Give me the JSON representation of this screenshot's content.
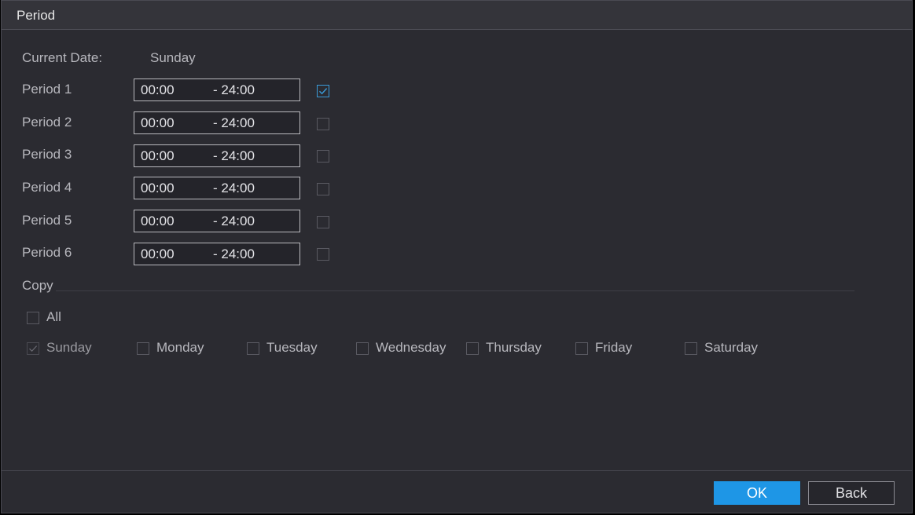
{
  "dialog": {
    "title": "Period",
    "current_date_label": "Current Date:",
    "current_date_value": "Sunday",
    "periods": [
      {
        "label": "Period 1",
        "start": "00:00",
        "end": "- 24:00",
        "checked": true
      },
      {
        "label": "Period 2",
        "start": "00:00",
        "end": "- 24:00",
        "checked": false
      },
      {
        "label": "Period 3",
        "start": "00:00",
        "end": "- 24:00",
        "checked": false
      },
      {
        "label": "Period 4",
        "start": "00:00",
        "end": "- 24:00",
        "checked": false
      },
      {
        "label": "Period 5",
        "start": "00:00",
        "end": "- 24:00",
        "checked": false
      },
      {
        "label": "Period 6",
        "start": "00:00",
        "end": "- 24:00",
        "checked": false
      }
    ],
    "copy_label": "Copy",
    "all_label": "All",
    "days": [
      {
        "label": "Sunday",
        "checked": true,
        "disabled": true
      },
      {
        "label": "Monday",
        "checked": false
      },
      {
        "label": "Tuesday",
        "checked": false
      },
      {
        "label": "Wednesday",
        "checked": false
      },
      {
        "label": "Thursday",
        "checked": false
      },
      {
        "label": "Friday",
        "checked": false
      },
      {
        "label": "Saturday",
        "checked": false
      }
    ],
    "ok_label": "OK",
    "back_label": "Back"
  },
  "colors": {
    "accent": "#1e96e6",
    "background": "#2b2b31",
    "checkbox_checked": "#3a9bd8"
  }
}
